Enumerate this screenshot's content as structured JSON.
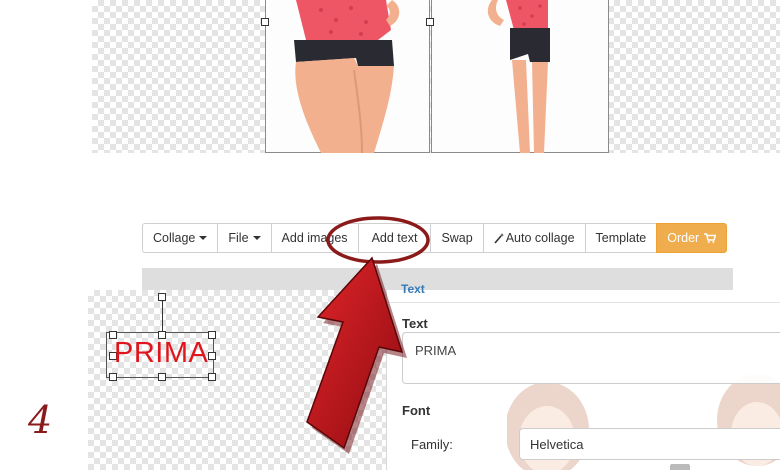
{
  "toolbar": {
    "collage": "Collage",
    "file": "File",
    "add_images": "Add images",
    "add_text": "Add text",
    "swap": "Swap",
    "auto_collage": "Auto collage",
    "template": "Template",
    "order": "Order"
  },
  "panel": {
    "section_header": "Text",
    "text_label": "Text",
    "text_value": "PRIMA",
    "font_label": "Font",
    "family_label": "Family:",
    "family_value": "Helvetica"
  },
  "canvas": {
    "text_item": "PRIMA"
  },
  "step_number": "4",
  "colors": {
    "order": "#f0ad4e",
    "arrow": "#b30f14",
    "canvas_text": "#e0141c",
    "highlight_ring": "#8b1a1a"
  },
  "icons": {
    "cart": "cart-icon",
    "wand": "magic-wand-icon"
  }
}
